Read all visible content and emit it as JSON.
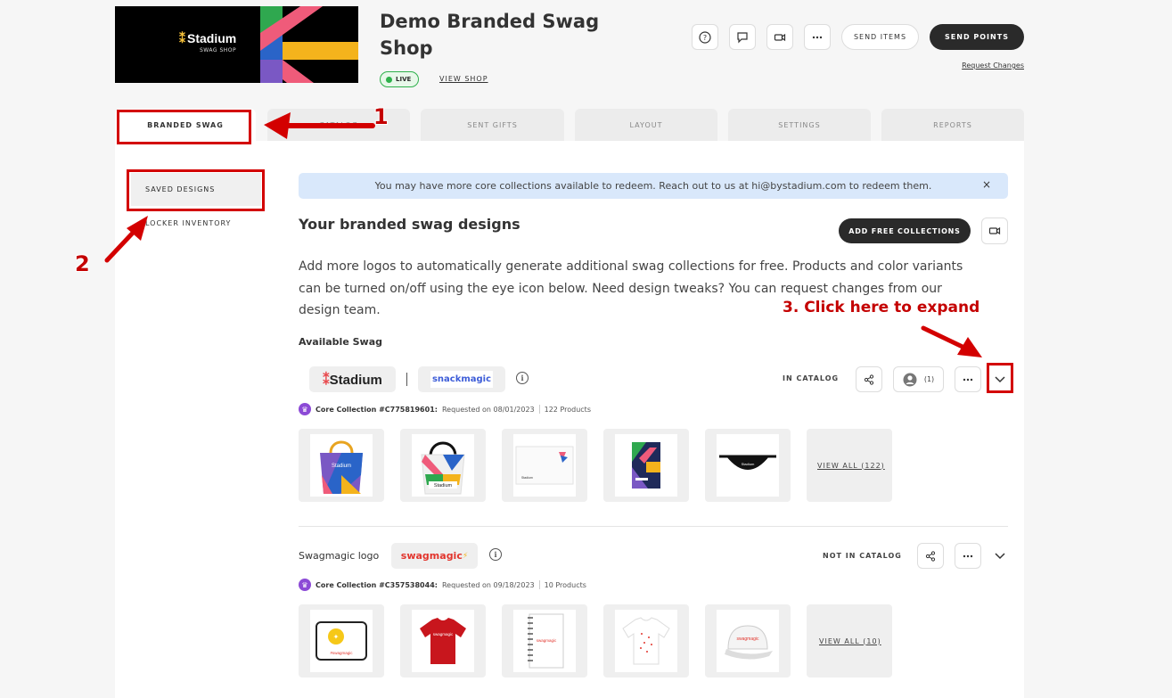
{
  "header": {
    "hero_brand": "Stadium",
    "hero_sub": "SWAG SHOP",
    "title": "Demo Branded Swag Shop",
    "live_badge": "LIVE",
    "view_shop": "VIEW SHOP",
    "send_items": "SEND ITEMS",
    "send_points": "SEND POINTS",
    "request_changes": "Request Changes",
    "icons": [
      "help-icon",
      "chat-icon",
      "video-icon",
      "more-icon"
    ]
  },
  "tabs": [
    {
      "label": "BRANDED SWAG",
      "active": true
    },
    {
      "label": "CATALOG",
      "active": false
    },
    {
      "label": "SENT GIFTS",
      "active": false
    },
    {
      "label": "LAYOUT",
      "active": false
    },
    {
      "label": "SETTINGS",
      "active": false
    },
    {
      "label": "REPORTS",
      "active": false
    }
  ],
  "sidebar": {
    "items": [
      {
        "label": "SAVED DESIGNS",
        "active": true
      },
      {
        "label": "LOCKER INVENTORY",
        "active": false
      }
    ]
  },
  "banner": {
    "text": "You may have more core collections available to redeem. Reach out to us at hi@bystadium.com to redeem them.",
    "close": "×"
  },
  "main": {
    "title": "Your branded swag designs",
    "add_free": "ADD FREE COLLECTIONS",
    "description": "Add more logos to automatically generate additional swag collections for free. Products and color variants can be turned on/off using the eye icon below. Need design tweaks? You can request changes from our design team.",
    "available_label": "Available Swag"
  },
  "collections": [
    {
      "logo1": "Stadium",
      "logo2": "snackmagic",
      "status": "IN CATALOG",
      "user_count": "(1)",
      "collection_id": "Core Collection #C775819601:",
      "requested": "Requested on 08/01/2023",
      "products": "122 Products",
      "view_all": "VIEW ALL (122)",
      "products_thumbs": [
        "tote-bag",
        "beach-bag",
        "envelope",
        "notebook",
        "fanny-pack"
      ]
    },
    {
      "name": "Swagmagic logo",
      "logo": "swagmagic",
      "status": "NOT IN CATALOG",
      "collection_id": "Core Collection #C357538044:",
      "requested": "Requested on 09/18/2023",
      "products": "10 Products",
      "view_all": "VIEW ALL (10)",
      "products_thumbs": [
        "laptop-sleeve",
        "red-tshirt",
        "spiral-notebook",
        "white-tshirt",
        "cap"
      ]
    }
  ],
  "annotations": {
    "n1": "1",
    "n2": "2",
    "n3": "3. Click here to expand"
  },
  "colors": {
    "accent_dark": "#2a2a2a",
    "live_green": "#2fb14c",
    "banner_blue": "#d9e8fb",
    "annotation_red": "#d30000",
    "crown_purple": "#8c4ad6"
  }
}
